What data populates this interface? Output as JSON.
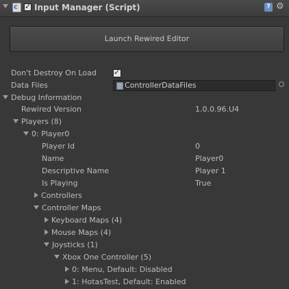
{
  "header": {
    "title": "Input Manager (Script)",
    "enabled": true,
    "script_icon_glyph": "c"
  },
  "launch_button": {
    "label": "Launch Rewired Editor"
  },
  "fields": {
    "dont_destroy_label": "Don't Destroy On Load",
    "dont_destroy_value": true,
    "data_files_label": "Data Files",
    "data_files_value": "ControllerDataFiles"
  },
  "debug": {
    "section_label": "Debug Information",
    "rewired_version_label": "Rewired Version",
    "rewired_version_value": "1.0.0.96.U4",
    "players_label": "Players (8)",
    "player0": {
      "label": "0: Player0",
      "player_id_label": "Player Id",
      "player_id_value": "0",
      "name_label": "Name",
      "name_value": "Player0",
      "descriptive_name_label": "Descriptive Name",
      "descriptive_name_value": "Player 1",
      "is_playing_label": "Is Playing",
      "is_playing_value": "True",
      "controllers_label": "Controllers",
      "controller_maps_label": "Controller Maps",
      "keyboard_maps_label": "Keyboard Maps (4)",
      "mouse_maps_label": "Mouse Maps (4)",
      "joysticks_label": "Joysticks (1)",
      "xbox_label": "Xbox One Controller (5)",
      "map0_label": "0: Menu, Default: Disabled",
      "map1_label": "1: HotasTest, Default: Enabled"
    }
  }
}
